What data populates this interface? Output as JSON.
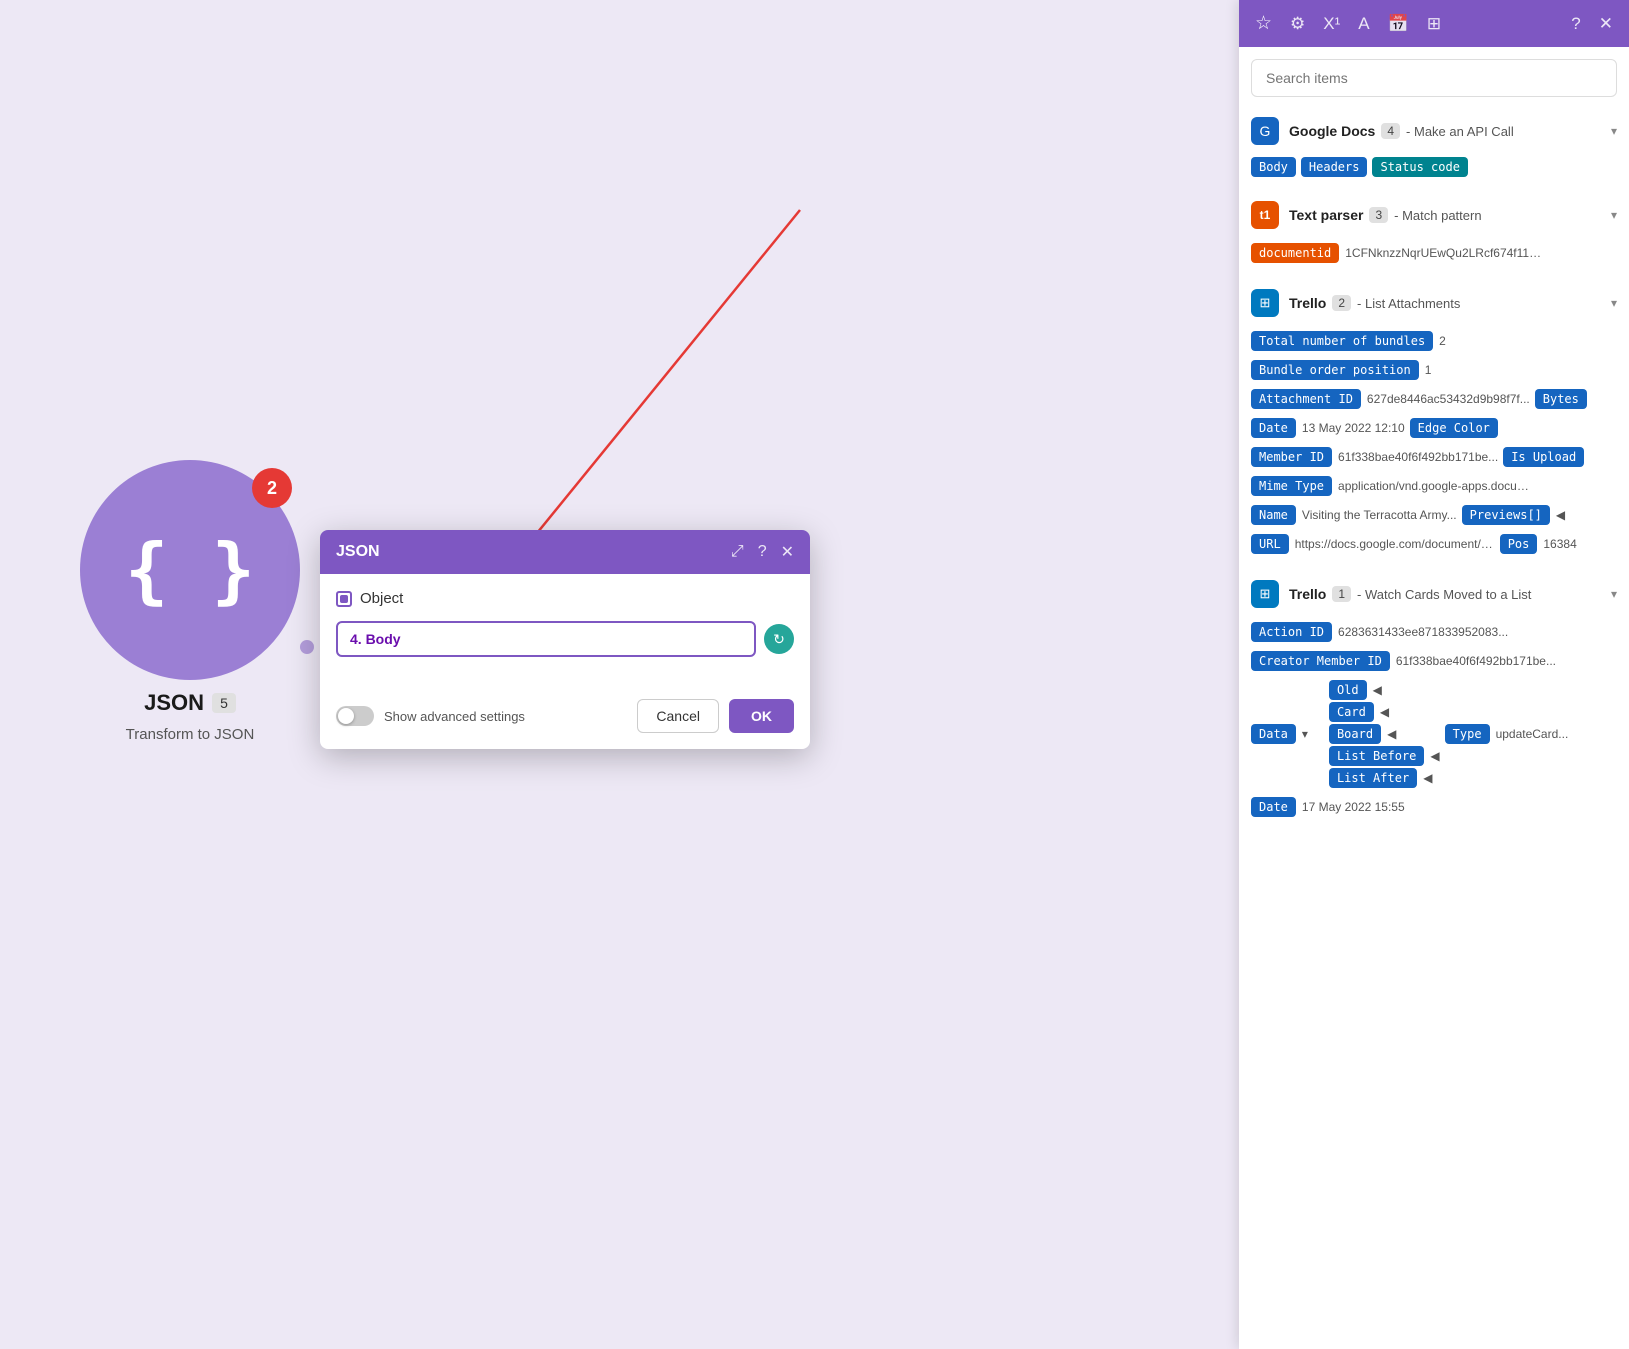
{
  "canvas": {
    "background": "#ede8f5"
  },
  "json_node": {
    "badge": "2",
    "title": "JSON",
    "number": "5",
    "subtitle": "Transform to JSON"
  },
  "dialog": {
    "title": "JSON",
    "object_label": "Object",
    "input_value": "4. Body",
    "show_advanced_label": "Show advanced settings",
    "cancel_label": "Cancel",
    "ok_label": "OK"
  },
  "panel": {
    "search_placeholder": "Search items",
    "toolbar_icons": [
      "star",
      "gear",
      "superscript",
      "font",
      "calendar",
      "table",
      "help",
      "close"
    ],
    "sections": [
      {
        "id": "google-docs",
        "icon_type": "blue",
        "icon_text": "G",
        "name": "Google Docs",
        "number": "4",
        "method": "- Make an API Call",
        "expanded": true,
        "items": [
          {
            "tag": "Body",
            "tag_color": "blue",
            "value": ""
          },
          {
            "tag": "Headers",
            "tag_color": "blue",
            "value": ""
          },
          {
            "tag": "Status code",
            "tag_color": "teal",
            "value": ""
          }
        ]
      },
      {
        "id": "text-parser",
        "icon_type": "orange",
        "icon_text": "T",
        "name": "Text parser",
        "number": "3",
        "method": "- Match pattern",
        "expanded": true,
        "items": [
          {
            "tag": "documentid",
            "tag_color": "orange",
            "value": "1CFNknzzNqrUEwQu2LRcf674f11ElYev..."
          }
        ]
      },
      {
        "id": "trello-2",
        "icon_type": "trello",
        "icon_text": "T",
        "name": "Trello",
        "number": "2",
        "method": "- List Attachments",
        "expanded": true,
        "items": [
          {
            "tag": "Total number of bundles",
            "tag_color": "blue",
            "value": "2"
          },
          {
            "tag": "Bundle order position",
            "tag_color": "blue",
            "value": "1"
          },
          {
            "tag": "Attachment ID",
            "tag_color": "blue",
            "value": "627de8446ac53432d9b98f7f..."
          },
          {
            "tag": "Bytes",
            "tag_color": "blue",
            "value": ""
          },
          {
            "tag": "Date",
            "tag_color": "blue",
            "value": "13 May 2022 12:10"
          },
          {
            "tag": "Edge Color",
            "tag_color": "blue",
            "value": ""
          },
          {
            "tag": "Member ID",
            "tag_color": "blue",
            "value": "61f338bae40f6f492bb171be..."
          },
          {
            "tag": "Is Upload",
            "tag_color": "blue",
            "value": ""
          },
          {
            "tag": "Mime Type",
            "tag_color": "blue",
            "value": "application/vnd.google-apps.document..."
          },
          {
            "tag": "Name",
            "tag_color": "blue",
            "value": "Visiting the Terracotta Army..."
          },
          {
            "tag": "Previews[]",
            "tag_color": "blue",
            "value": "",
            "has_arrow": true
          },
          {
            "tag": "URL",
            "tag_color": "blue",
            "value": "https://docs.google.com/document/d/1CFNknz..."
          },
          {
            "tag": "Pos",
            "tag_color": "blue",
            "value": "16384"
          }
        ]
      },
      {
        "id": "trello-1",
        "icon_type": "trello",
        "icon_text": "T",
        "name": "Trello",
        "number": "1",
        "method": "- Watch Cards Moved to a List",
        "expanded": true,
        "items": [
          {
            "tag": "Action ID",
            "tag_color": "blue",
            "value": "6283631433ee871833952083..."
          },
          {
            "tag": "Creator Member ID",
            "tag_color": "blue",
            "value": "61f338bae40f6f492bb171be..."
          },
          {
            "tag": "Data",
            "tag_color": "blue",
            "value": "",
            "has_arrow": true,
            "expanded": true
          },
          {
            "tag": "Old",
            "tag_color": "blue",
            "value": "",
            "has_arrow": true,
            "nested": true
          },
          {
            "tag": "Card",
            "tag_color": "blue",
            "value": "",
            "has_arrow": true,
            "nested": true
          },
          {
            "tag": "Board",
            "tag_color": "blue",
            "value": "",
            "has_arrow": true,
            "nested": true
          },
          {
            "tag": "List Before",
            "tag_color": "blue",
            "value": "",
            "has_arrow": true,
            "nested": true
          },
          {
            "tag": "List After",
            "tag_color": "blue",
            "value": "",
            "has_arrow": true,
            "nested": true
          },
          {
            "tag": "Type",
            "tag_color": "blue",
            "value": "updateCard..."
          },
          {
            "tag": "Date",
            "tag_color": "blue",
            "value": "17 May 2022 15:55"
          }
        ]
      }
    ]
  }
}
